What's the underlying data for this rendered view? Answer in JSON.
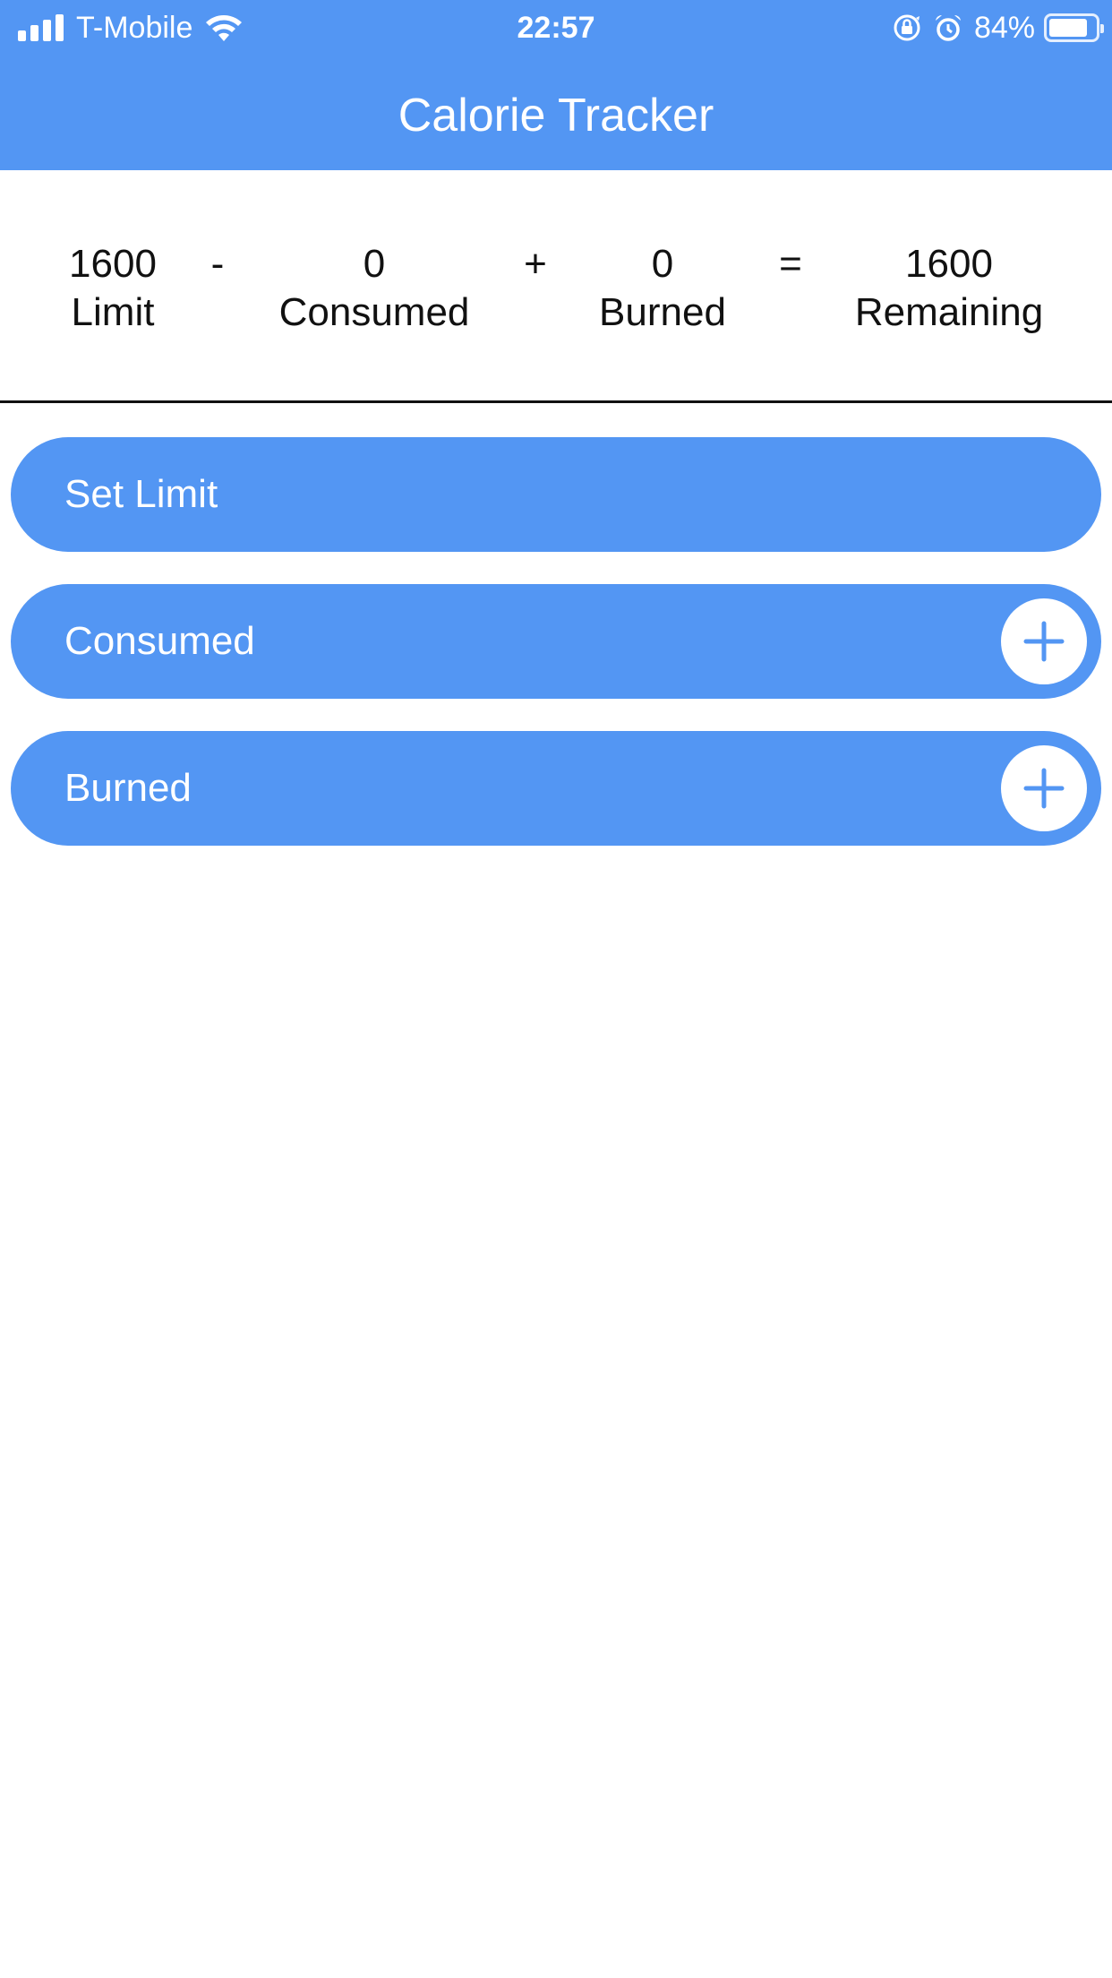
{
  "status_bar": {
    "carrier": "T-Mobile",
    "time": "22:57",
    "battery_percent": "84%",
    "icons": [
      "signal-icon",
      "wifi-icon",
      "orientation-lock-icon",
      "alarm-icon",
      "battery-icon"
    ]
  },
  "header": {
    "title": "Calorie Tracker"
  },
  "summary": {
    "limit": {
      "value": "1600",
      "label": "Limit"
    },
    "minus": "-",
    "consumed": {
      "value": "0",
      "label": "Consumed"
    },
    "plus": "+",
    "burned": {
      "value": "0",
      "label": "Burned"
    },
    "equals": "=",
    "remaining": {
      "value": "1600",
      "label": "Remaining"
    }
  },
  "actions": {
    "set_limit": "Set Limit",
    "consumed": "Consumed",
    "burned": "Burned"
  },
  "colors": {
    "accent": "#5396f3",
    "background": "#ffffff",
    "text": "#111111"
  }
}
